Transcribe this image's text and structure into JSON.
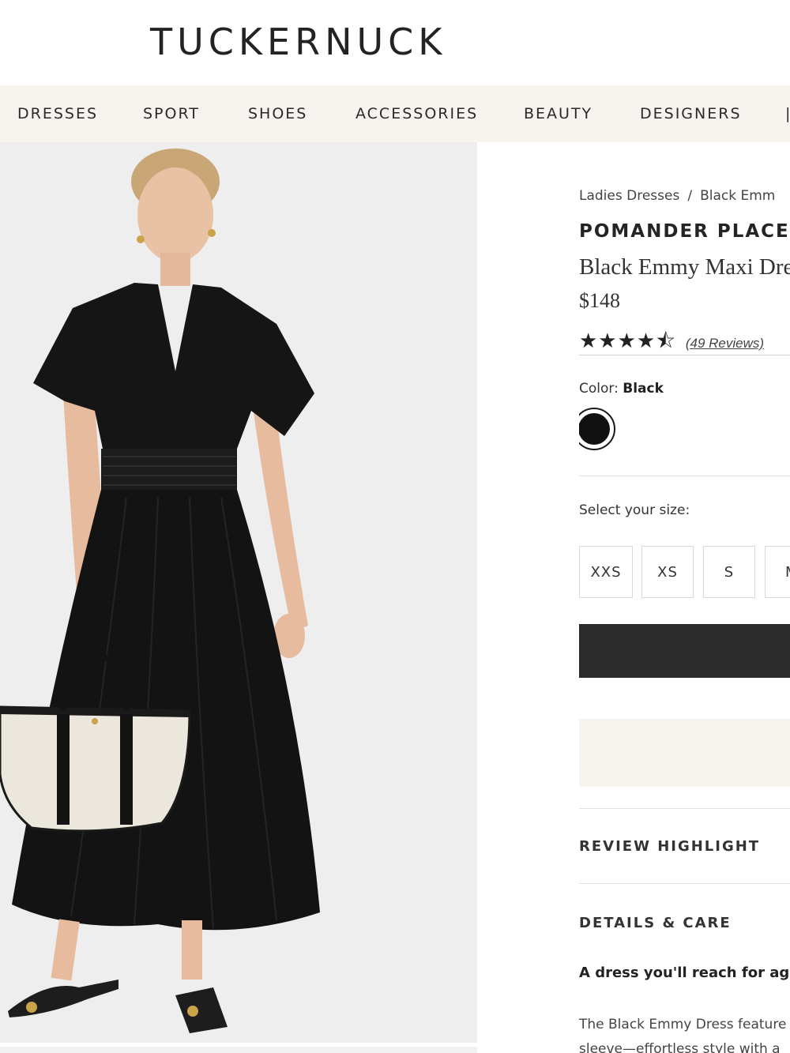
{
  "header": {
    "logo": "TUCKERNUCK"
  },
  "nav": {
    "items": [
      "DRESSES",
      "SPORT",
      "SHOES",
      "ACCESSORIES",
      "BEAUTY",
      "DESIGNERS"
    ]
  },
  "breadcrumb": {
    "items": [
      "Ladies Dresses",
      "Black Emm"
    ],
    "separator": "/"
  },
  "product": {
    "brand": "POMANDER PLACE",
    "name": "Black Emmy Maxi Dre",
    "price": "$148",
    "stars": "★★★★⯪",
    "rating": 4.5,
    "reviews_label": "(49 Reviews)",
    "color_label": "Color:",
    "color_value": "Black",
    "swatch_color": "#111111",
    "size_label": "Select your size:",
    "sizes": [
      "XXS",
      "XS",
      "S",
      "M"
    ]
  },
  "sections": {
    "review_highlight": "REVIEW HIGHLIGHT",
    "details_care": "DETAILS & CARE"
  },
  "description": {
    "tagline": "A dress you'll reach for agai",
    "line1": "The Black Emmy Dress feature",
    "line2": "sleeve—effortless style with a"
  },
  "colors": {
    "nav_bg": "#f7f4ef",
    "button_dark": "#2b2b2b",
    "button_light": "#f7f4ef"
  }
}
